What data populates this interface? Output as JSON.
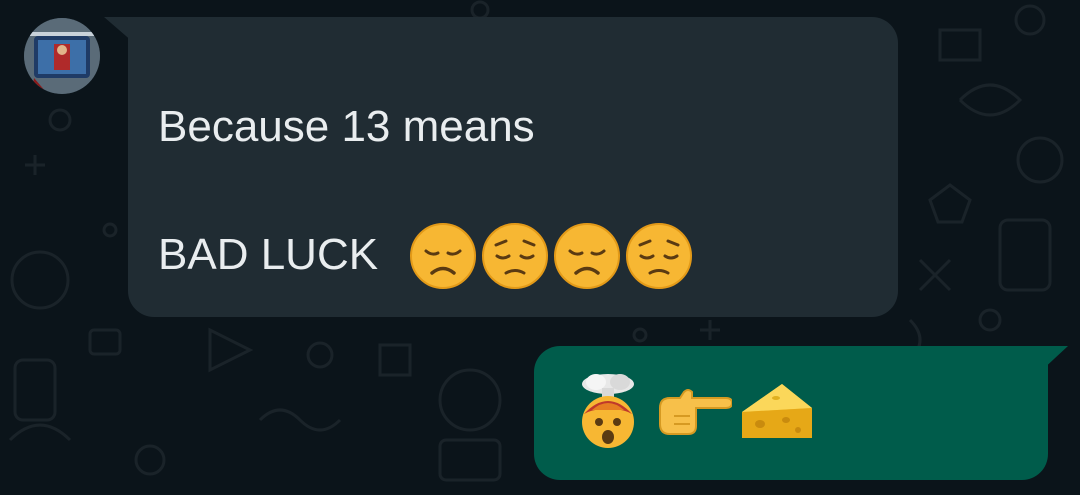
{
  "chat": {
    "incoming": {
      "sender_avatar_icon": "contact-avatar",
      "line_1": "Because 13 means",
      "line_2": "BAD LUCK",
      "emojis": [
        "disappointed-face",
        "pensive-face",
        "disappointed-face",
        "pensive-face"
      ]
    },
    "outgoing": {
      "emojis": [
        "exploding-head",
        "backhand-index-pointing-right",
        "cheese-wedge"
      ]
    }
  },
  "colors": {
    "background": "#0b141a",
    "incoming_bubble": "#202c33",
    "outgoing_bubble": "#005c4b",
    "text": "#e9edef"
  }
}
